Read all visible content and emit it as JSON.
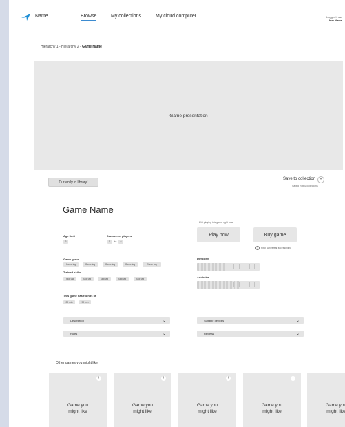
{
  "brand": "Name",
  "nav": {
    "browse": "Browse",
    "collections": "My collections",
    "cloud": "My cloud computer"
  },
  "login": {
    "line1": "Logged in as",
    "user": "User Name"
  },
  "breadcrumb": {
    "h1": "Hierarchy 1",
    "sep": " - ",
    "h2": "Hierarchy 2",
    "current": "Game Name"
  },
  "hero_label": "Game presentation",
  "library_button": "Currently in library!",
  "save": {
    "label": "Save to collection",
    "plus": "+",
    "sub": "Saved in 402 collections"
  },
  "game_name": "Game Name",
  "playing_now": "215 playing this game right now!",
  "play_button": "Play now",
  "buy_button": "Buy game",
  "universal": {
    "icon": "i",
    "text": "Fit of Universal accessibility"
  },
  "age": {
    "label": "Age limit",
    "value": "3"
  },
  "players": {
    "label": "Number of players",
    "from": "1",
    "sep": "to",
    "to": "6"
  },
  "genre": {
    "label": "Game genre",
    "tags": [
      "Game tag",
      "Game tag",
      "Game tag",
      "Game tag",
      "Game tag"
    ]
  },
  "skills": {
    "label": "Trained skills",
    "tags": [
      "Skill tag",
      "Skill tag",
      "Skill tag",
      "Skill tag",
      "Skill tag"
    ]
  },
  "rounds": {
    "label": "This game has rounds of",
    "values": [
      "20 min",
      "90 min"
    ]
  },
  "difficulty": {
    "label": "Difficulty",
    "level": 0.45
  },
  "addictive": {
    "label": "Addictive",
    "level": 0.7
  },
  "accordions": {
    "description": "Description",
    "rules": "Rules",
    "devices": "Suitable devices",
    "reviews": "Reviews"
  },
  "other_title": "Other games you might like",
  "cards": [
    {
      "line1": "Game you",
      "line2": "might like"
    },
    {
      "line1": "Game you",
      "line2": "might like"
    },
    {
      "line1": "Game you",
      "line2": "might like"
    },
    {
      "line1": "Game you",
      "line2": "might like"
    },
    {
      "line1": "Game you",
      "line2": "might like"
    }
  ],
  "colors": {
    "accent": "#1e8fd6",
    "nav_underline": "#3c8bd0"
  }
}
